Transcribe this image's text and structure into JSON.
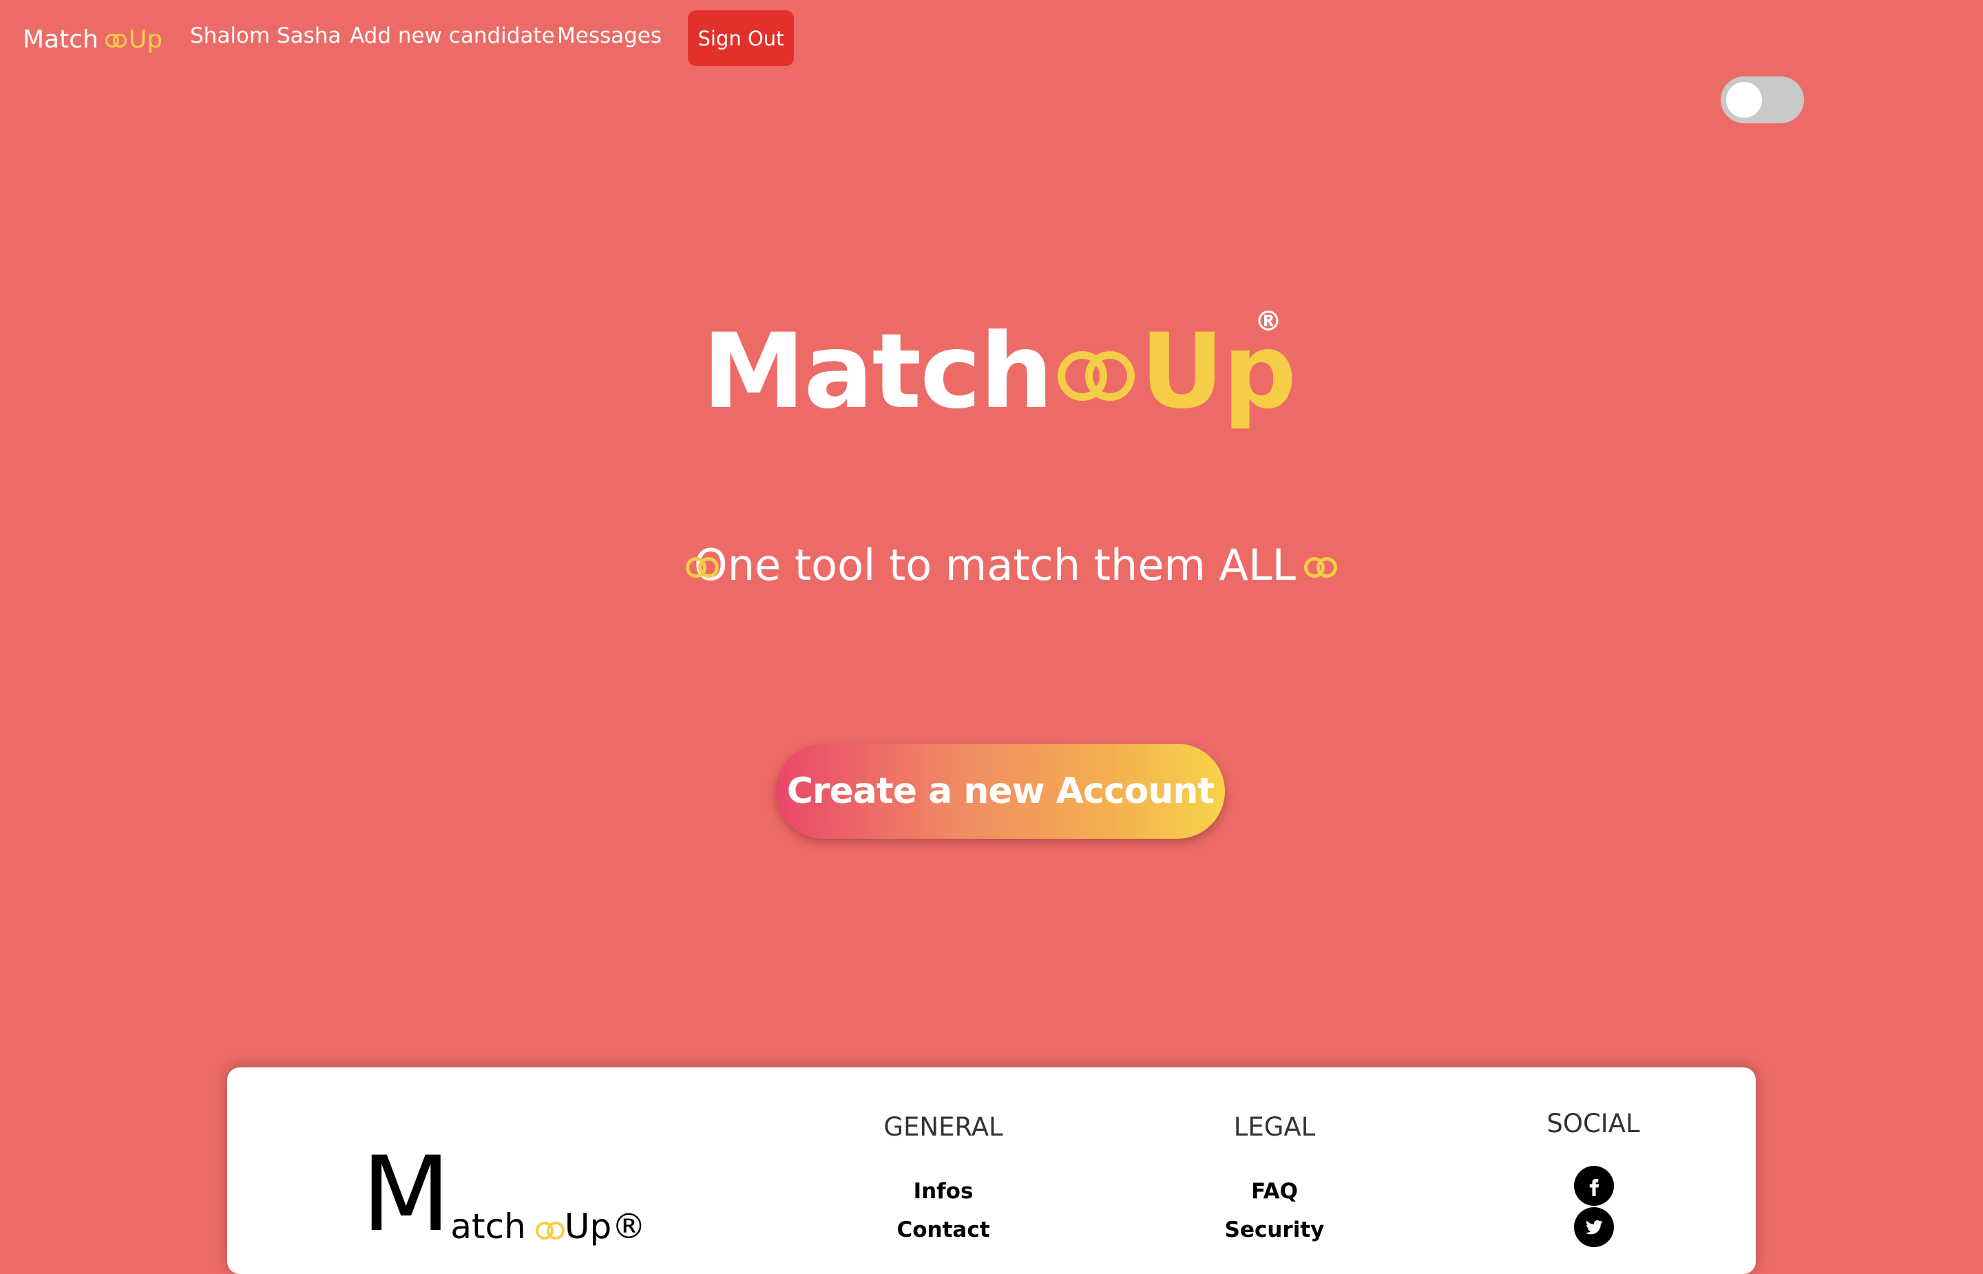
{
  "nav": {
    "brand": {
      "word1": "Match",
      "word2": "Up"
    },
    "links": [
      "Shalom Sasha",
      "Add new candidate",
      "Messages"
    ],
    "sign_out": "Sign Out"
  },
  "hero": {
    "title1": "Match",
    "title2": "Up",
    "registered": "®",
    "tagline": "One tool to match them ALL",
    "cta": "Create a new Account"
  },
  "footer": {
    "logo": {
      "initial": "M",
      "rest": "atch",
      "up": "Up®"
    },
    "columns": [
      {
        "heading": "GENERAL",
        "links": [
          "Infos",
          "Contact"
        ]
      },
      {
        "heading": "LEGAL",
        "links": [
          "FAQ",
          "Security"
        ]
      },
      {
        "heading": "SOCIAL",
        "icons": [
          "facebook-icon",
          "twitter-icon"
        ]
      }
    ]
  },
  "colors": {
    "background": "#ed6b67",
    "accent": "#f6cd47",
    "sign_out": "#e4302a"
  }
}
